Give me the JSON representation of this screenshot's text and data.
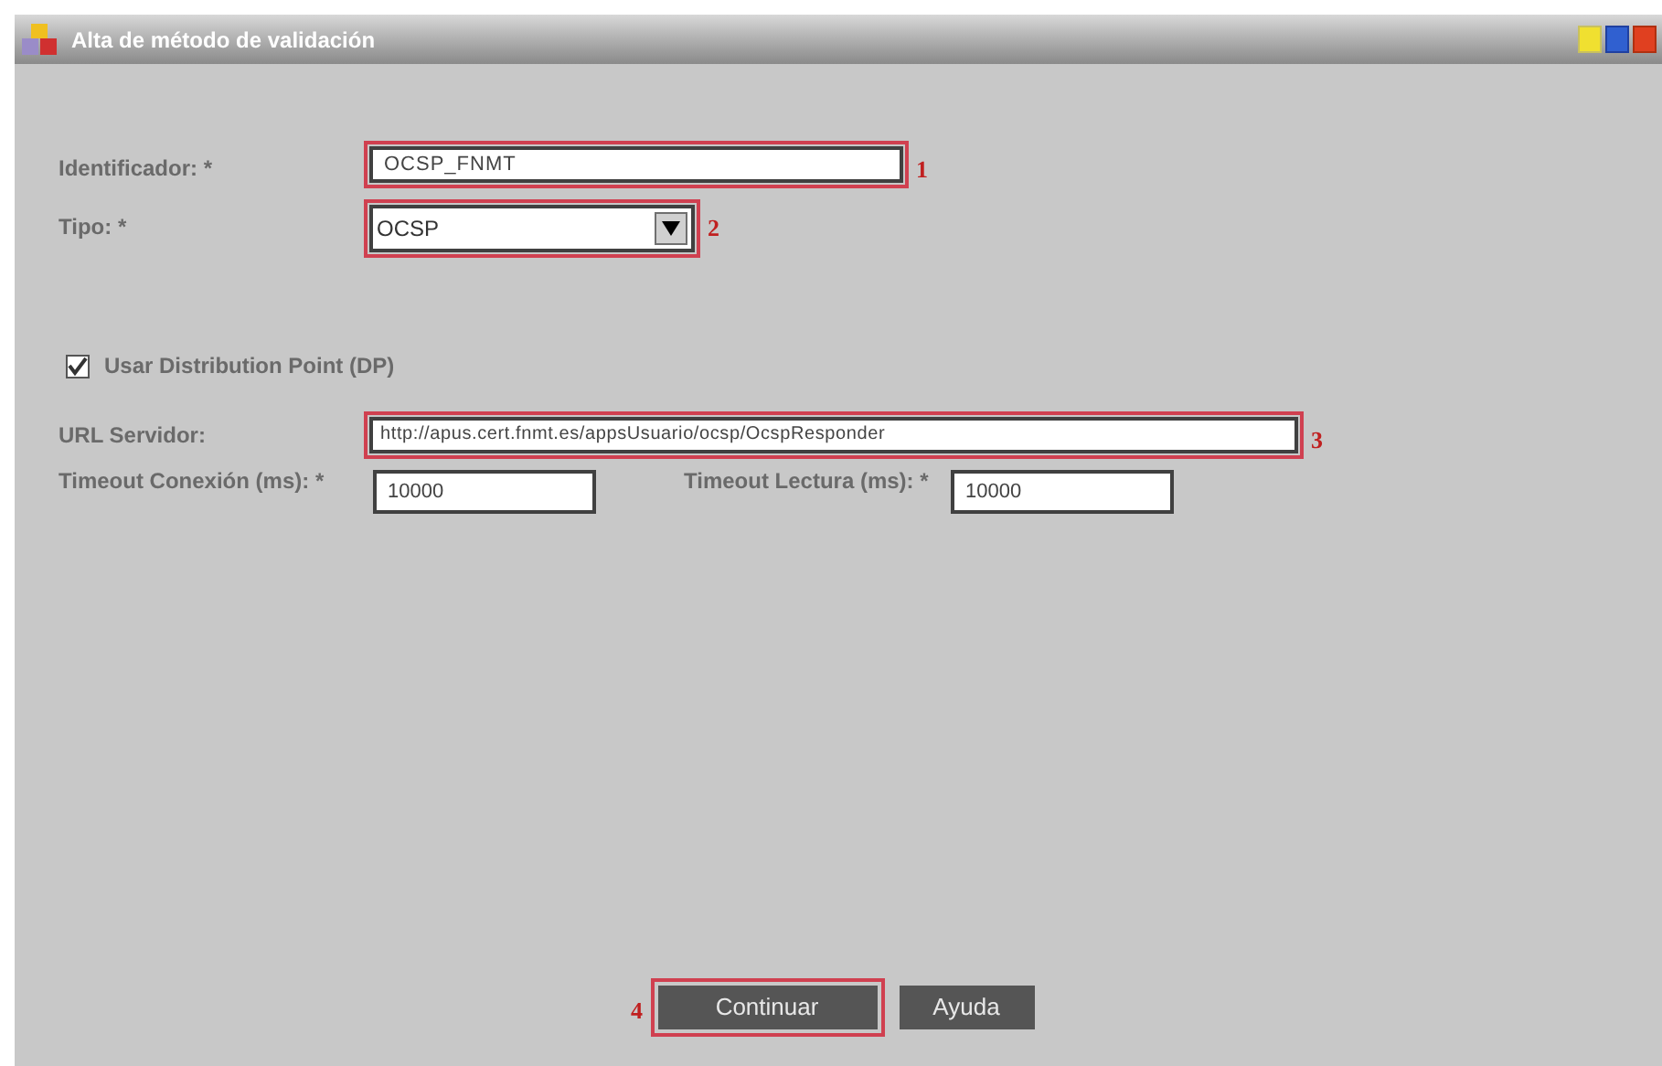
{
  "window": {
    "title": "Alta de método de validación"
  },
  "fields": [
    {
      "kind": "text",
      "label": "Identificador: *",
      "value": "OCSP_FNMT",
      "marker": "1"
    },
    {
      "kind": "select",
      "label": "Tipo: *",
      "value": "OCSP",
      "marker": "2"
    }
  ],
  "checkbox": {
    "label": "Usar Distribution Point (DP)",
    "checked": true
  },
  "url": {
    "label": "URL Servidor:",
    "value": "http://apus.cert.fnmt.es/appsUsuario/ocsp/OcspResponder",
    "marker": "3"
  },
  "timeouts": [
    {
      "label": "Timeout Conexión (ms): *",
      "value": "10000"
    },
    {
      "label": "Timeout Lectura (ms): *",
      "value": "10000"
    }
  ],
  "buttons": [
    {
      "label": "Continuar",
      "marker": "4"
    },
    {
      "label": "Ayuda"
    }
  ]
}
